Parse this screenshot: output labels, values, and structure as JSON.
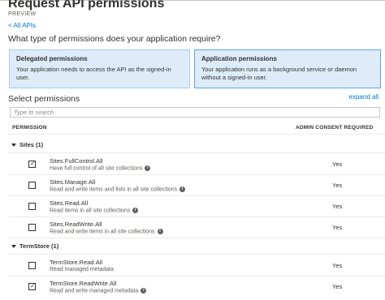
{
  "header": {
    "title": "Request API permissions",
    "subtitle": "PREVIEW"
  },
  "nav": {
    "back_link": "< All APIs"
  },
  "question": "What type of permissions does your application require?",
  "permission_types": [
    {
      "title": "Delegated permissions",
      "description": "Your application needs to access the API as the signed-in user.",
      "selected": false
    },
    {
      "title": "Application permissions",
      "description": "Your application runs as a background service or daemon without a signed-in user.",
      "selected": true
    }
  ],
  "select_permissions": {
    "label": "Select permissions",
    "expand_all": "expand all",
    "search_placeholder": "Type to search",
    "columns": {
      "permission": "PERMISSION",
      "admin_consent": "ADMIN CONSENT REQUIRED"
    }
  },
  "groups": [
    {
      "name": "Sites (1)",
      "permissions": [
        {
          "name": "Sites.FullControl.All",
          "description": "Have full control of all site collections",
          "checked": true,
          "admin_consent": "Yes"
        },
        {
          "name": "Sites.Manage.All",
          "description": "Read and write items and lists in all site collections",
          "checked": false,
          "admin_consent": "Yes"
        },
        {
          "name": "Sites.Read.All",
          "description": "Read items in all site collections",
          "checked": false,
          "admin_consent": "Yes"
        },
        {
          "name": "Sites.ReadWrite.All",
          "description": "Read and write items in all site collections",
          "checked": false,
          "admin_consent": "Yes"
        }
      ]
    },
    {
      "name": "TermStore (1)",
      "permissions": [
        {
          "name": "TermStore.Read.All",
          "description": "Read managed metadata",
          "checked": false,
          "admin_consent": "Yes"
        },
        {
          "name": "TermStore.ReadWrite.All",
          "description": "Read and write managed metadata",
          "checked": true,
          "admin_consent": "Yes"
        }
      ]
    }
  ],
  "colors": {
    "accent": "#0078d4",
    "selected_card_bg": "#deecf9",
    "border": "#c8c6c4"
  }
}
